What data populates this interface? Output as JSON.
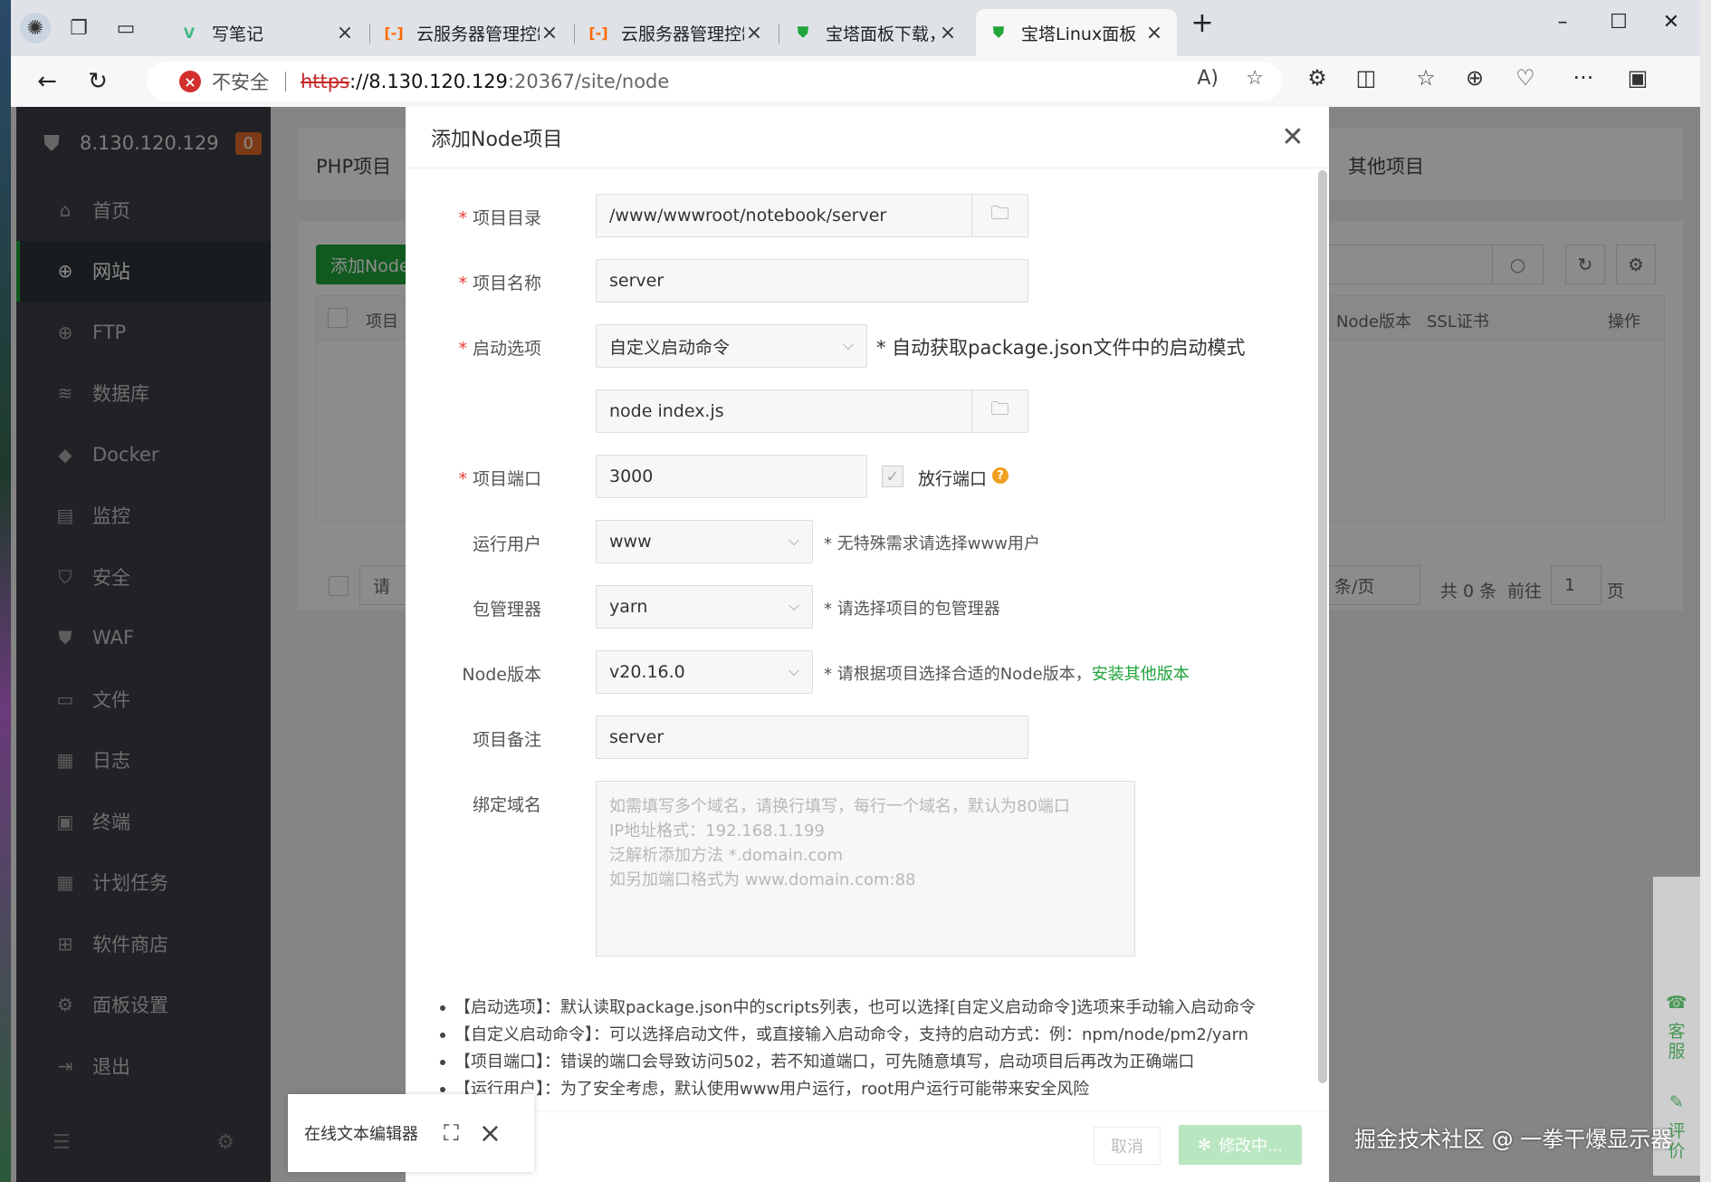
{
  "browser": {
    "tabs": [
      {
        "title": "写笔记",
        "icon": "vue-icon",
        "color": "#41b883"
      },
      {
        "title": "云服务器管理控制台",
        "icon": "aliyun-icon",
        "color": "#ff6a00"
      },
      {
        "title": "云服务器管理控制台",
        "icon": "aliyun-icon",
        "color": "#ff6a00"
      },
      {
        "title": "宝塔面板下载，免费全",
        "icon": "bt-shield-icon",
        "color": "#20a53a"
      },
      {
        "title": "宝塔Linux面板",
        "icon": "bt-shield-icon",
        "color": "#20a53a"
      }
    ],
    "address": {
      "security_label": "不安全",
      "scheme": "https",
      "host": "://8.130.120.129",
      "path": ":20367/site/node"
    }
  },
  "sidebar": {
    "server_ip": "8.130.120.129",
    "badge": "0",
    "items": [
      {
        "label": "首页",
        "icon": "home-icon"
      },
      {
        "label": "网站",
        "icon": "globe-icon"
      },
      {
        "label": "FTP",
        "icon": "ftp-icon"
      },
      {
        "label": "数据库",
        "icon": "database-icon"
      },
      {
        "label": "Docker",
        "icon": "docker-icon"
      },
      {
        "label": "监控",
        "icon": "monitor-icon"
      },
      {
        "label": "安全",
        "icon": "shield-icon"
      },
      {
        "label": "WAF",
        "icon": "waf-icon"
      },
      {
        "label": "文件",
        "icon": "folder-icon"
      },
      {
        "label": "日志",
        "icon": "log-icon"
      },
      {
        "label": "终端",
        "icon": "terminal-icon"
      },
      {
        "label": "计划任务",
        "icon": "calendar-icon"
      },
      {
        "label": "软件商店",
        "icon": "apps-icon"
      },
      {
        "label": "面板设置",
        "icon": "gear-icon"
      },
      {
        "label": "退出",
        "icon": "logout-icon"
      }
    ]
  },
  "background": {
    "tab_php": "PHP项目",
    "tab_other": "其他项目",
    "add_button": "添加Node",
    "col_project": "项目",
    "col_node_version": "Node版本",
    "col_ssl": "SSL证书",
    "col_action": "操作",
    "batch_placeholder": "请",
    "per_page": "条/页",
    "total": "共 0 条",
    "goto": "前往",
    "page_value": "1",
    "page_suffix": "页"
  },
  "modal": {
    "title": "添加Node项目",
    "dir_label": "项目目录",
    "dir_value": "/www/wwwroot/notebook/server",
    "name_label": "项目名称",
    "name_value": "server",
    "start_label": "启动选项",
    "start_value": "自定义启动命令",
    "start_hint": "* 自动获取package.json文件中的启动模式",
    "cmd_value": "node index.js",
    "port_label": "项目端口",
    "port_value": "3000",
    "port_release_label": "放行端口",
    "user_label": "运行用户",
    "user_value": "www",
    "user_hint": "* 无特殊需求请选择www用户",
    "pm_label": "包管理器",
    "pm_value": "yarn",
    "pm_hint": "* 请选择项目的包管理器",
    "node_label": "Node版本",
    "node_value": "v20.16.0",
    "node_hint": "* 请根据项目选择合适的Node版本，",
    "node_link": "安装其他版本",
    "remark_label": "项目备注",
    "remark_value": "server",
    "domain_label": "绑定域名",
    "domain_placeholder_1": "如需填写多个域名，请换行填写，每行一个域名，默认为80端口",
    "domain_placeholder_2": "IP地址格式：192.168.1.199",
    "domain_placeholder_3": "泛解析添加方法 *.domain.com",
    "domain_placeholder_4": "如另加端口格式为 www.domain.com:88",
    "notes": [
      "【启动选项】：默认读取package.json中的scripts列表，也可以选择[自定义启动命令]选项来手动输入启动命令",
      "【自定义启动命令】：可以选择启动文件，或直接输入启动命令，支持的启动方式：例：npm/node/pm2/yarn",
      "【项目端口】：错误的端口会导致访问502，若不知道端口，可先随意填写，启动项目后再改为正确端口",
      "【运行用户】：为了安全考虑，默认使用www用户运行，root用户运行可能带来安全风险"
    ],
    "cancel": "取消",
    "submit": "修改中..."
  },
  "editor_chip": {
    "label": "在线文本编辑器"
  },
  "service": {
    "kefu": "客服",
    "pingjia": "评价"
  },
  "watermark": "掘金技术社区 @ 一拳干爆显示器"
}
